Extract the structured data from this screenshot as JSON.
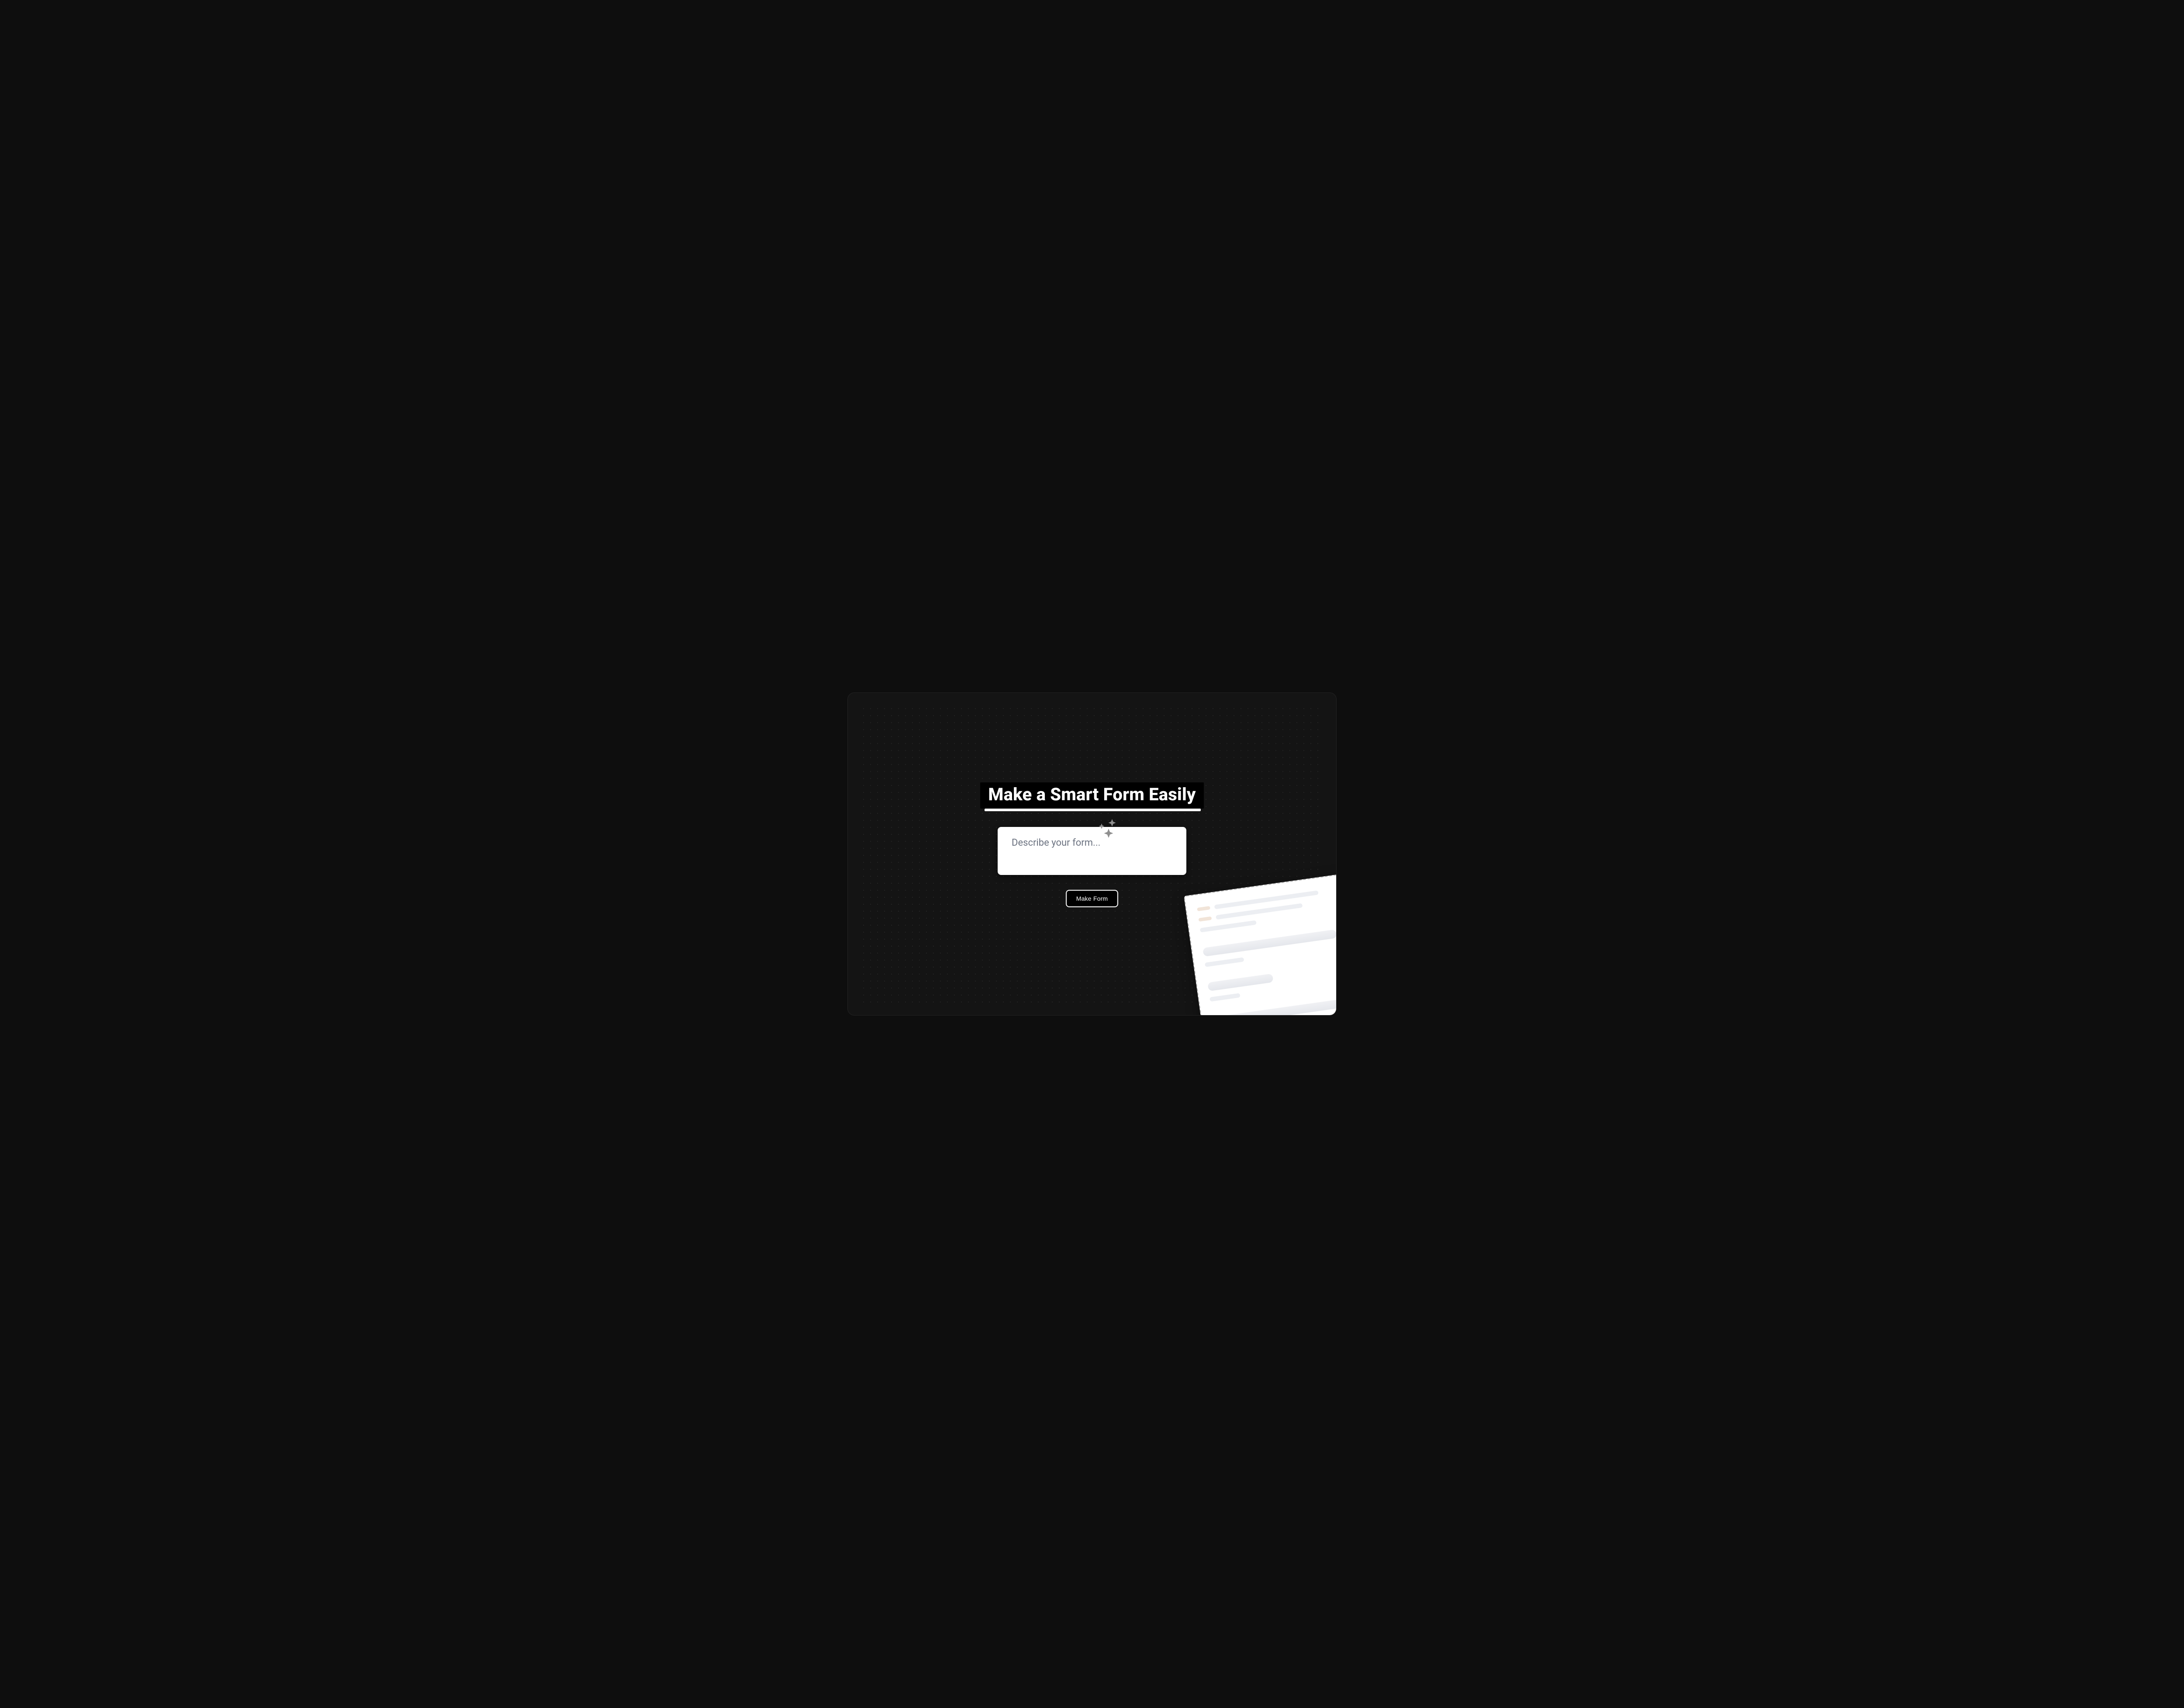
{
  "hero": {
    "headline": "Make a Smart Form Easily",
    "input_placeholder": "Describe your form...",
    "button_label": "Make Form"
  }
}
